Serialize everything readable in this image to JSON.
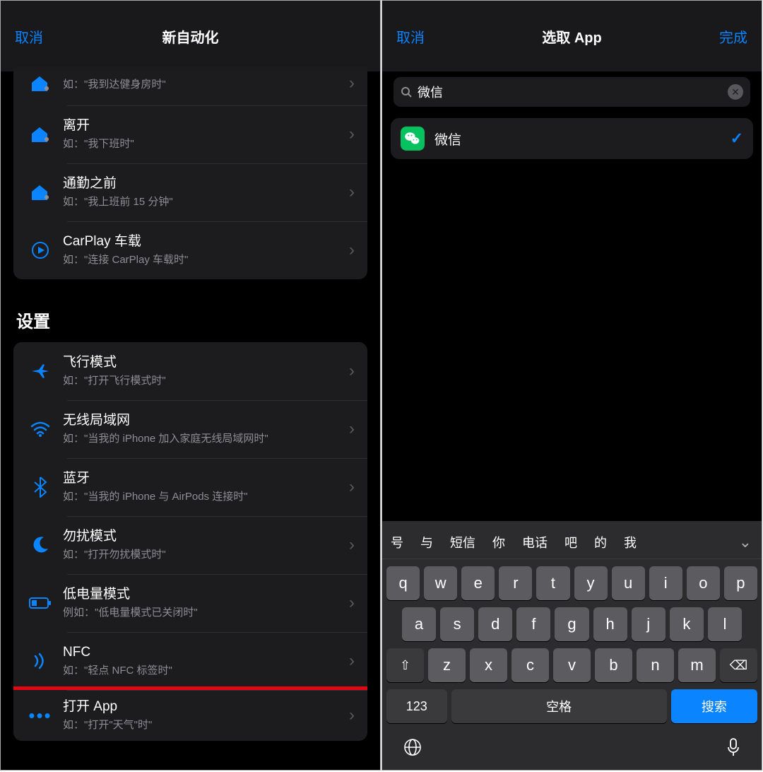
{
  "left": {
    "nav": {
      "cancel": "取消",
      "title": "新自动化"
    },
    "group1": [
      {
        "icon": "home-arrive-icon",
        "title": "",
        "sub": "如：\"我到达健身房时\""
      },
      {
        "icon": "home-leave-icon",
        "title": "离开",
        "sub": "如：\"我下班时\""
      },
      {
        "icon": "commute-icon",
        "title": "通勤之前",
        "sub": "如：\"我上班前 15 分钟\""
      },
      {
        "icon": "carplay-icon",
        "title": "CarPlay 车载",
        "sub": "如：\"连接 CarPlay 车载时\""
      }
    ],
    "section_title": "设置",
    "group2": [
      {
        "icon": "airplane-icon",
        "title": "飞行模式",
        "sub": "如：\"打开飞行模式时\""
      },
      {
        "icon": "wifi-icon",
        "title": "无线局域网",
        "sub": "如：\"当我的 iPhone 加入家庭无线局域网时\""
      },
      {
        "icon": "bluetooth-icon",
        "title": "蓝牙",
        "sub": "如：\"当我的 iPhone 与 AirPods 连接时\""
      },
      {
        "icon": "moon-icon",
        "title": "勿扰模式",
        "sub": "如：\"打开勿扰模式时\""
      },
      {
        "icon": "battery-icon",
        "title": "低电量模式",
        "sub": "例如：\"低电量模式已关闭时\""
      },
      {
        "icon": "nfc-icon",
        "title": "NFC",
        "sub": "如：\"轻点 NFC 标签时\""
      },
      {
        "icon": "open-app-icon",
        "title": "打开 App",
        "sub": "如：\"打开\"天气\"时\"",
        "highlight": true
      }
    ]
  },
  "right": {
    "nav": {
      "cancel": "取消",
      "title": "选取 App",
      "done": "完成"
    },
    "search": {
      "value": "微信"
    },
    "results": [
      {
        "name": "微信",
        "selected": true
      }
    ],
    "suggestions": [
      "号",
      "与",
      "短信",
      "你",
      "电话",
      "吧",
      "的",
      "我"
    ],
    "keys_row1": [
      "q",
      "w",
      "e",
      "r",
      "t",
      "y",
      "u",
      "i",
      "o",
      "p"
    ],
    "keys_row2": [
      "a",
      "s",
      "d",
      "f",
      "g",
      "h",
      "j",
      "k",
      "l"
    ],
    "keys_row3": [
      "z",
      "x",
      "c",
      "v",
      "b",
      "n",
      "m"
    ],
    "shift_label": "⇧",
    "backspace_label": "⌫",
    "num_label": "123",
    "space_label": "空格",
    "search_label": "搜索",
    "globe_label": "🌐",
    "mic_label": "🎤"
  }
}
